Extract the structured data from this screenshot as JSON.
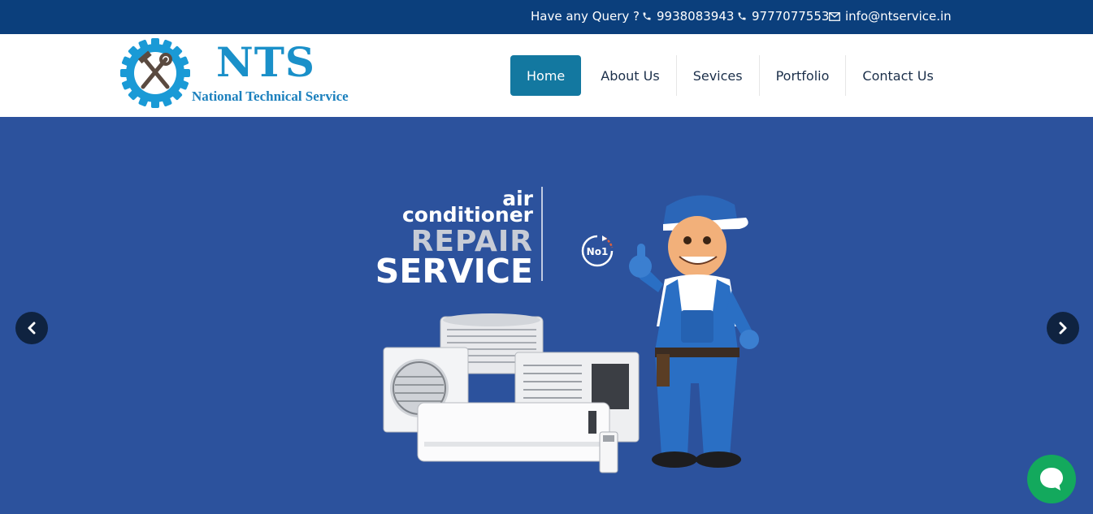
{
  "topbar": {
    "query_label": "Have any Query ?",
    "phone1": "9938083943",
    "phone2": "9777077553",
    "email": "info@ntservice.in"
  },
  "logo": {
    "title": "NTS",
    "subtitle": "National Technical Service"
  },
  "nav": {
    "items": [
      {
        "label": "Home",
        "active": true
      },
      {
        "label": "About Us"
      },
      {
        "label": "Sevices"
      },
      {
        "label": "Portfolio"
      },
      {
        "label": "Contact Us"
      }
    ]
  },
  "hero": {
    "line1": "air",
    "line2": "conditioner",
    "line3": "REPAIR",
    "line4": "SERVICE",
    "badge": "No1"
  },
  "colors": {
    "topbar": "#0b3f7c",
    "hero_bg": "#2c529d",
    "nav_active": "#1378a0",
    "chat": "#13a95d"
  },
  "icons": {
    "phone": "phone-icon",
    "email": "envelope-icon",
    "prev": "chevron-left-icon",
    "next": "chevron-right-icon",
    "chat": "chat-bubble-icon"
  }
}
